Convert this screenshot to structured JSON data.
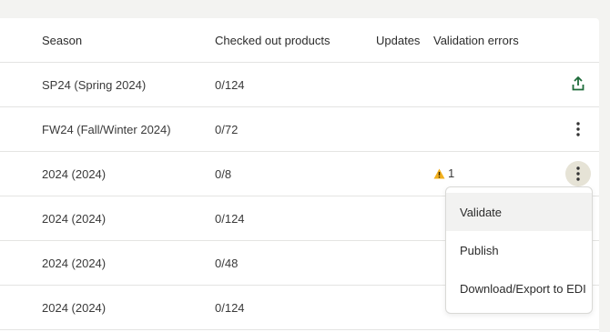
{
  "table": {
    "headers": {
      "season": "Season",
      "checked_out": "Checked out products",
      "updates": "Updates",
      "validation_errors": "Validation errors"
    },
    "rows": [
      {
        "season": "SP24 (Spring 2024)",
        "checked_out": "0/124",
        "updates": "",
        "validation_errors": "",
        "action": "upload-icon"
      },
      {
        "season": "FW24 (Fall/Winter 2024)",
        "checked_out": "0/72",
        "updates": "",
        "validation_errors": "",
        "action": "more-vertical-icon"
      },
      {
        "season": "2024 (2024)",
        "checked_out": "0/8",
        "updates": "",
        "validation_errors": "1",
        "action": "more-vertical-icon"
      },
      {
        "season": "2024 (2024)",
        "checked_out": "0/124",
        "updates": "",
        "validation_errors": "",
        "action": "none"
      },
      {
        "season": "2024 (2024)",
        "checked_out": "0/48",
        "updates": "",
        "validation_errors": "",
        "action": "none"
      },
      {
        "season": "2024 (2024)",
        "checked_out": "0/124",
        "updates": "",
        "validation_errors": "",
        "action": "none"
      }
    ]
  },
  "context_menu": {
    "items": [
      {
        "label": "Validate"
      },
      {
        "label": "Publish"
      },
      {
        "label": "Download/Export to EDI"
      }
    ]
  },
  "colors": {
    "accent_green": "#1e6b3a",
    "warning_yellow": "#f2b01e",
    "active_kebab_bg": "#e6e3d6"
  }
}
